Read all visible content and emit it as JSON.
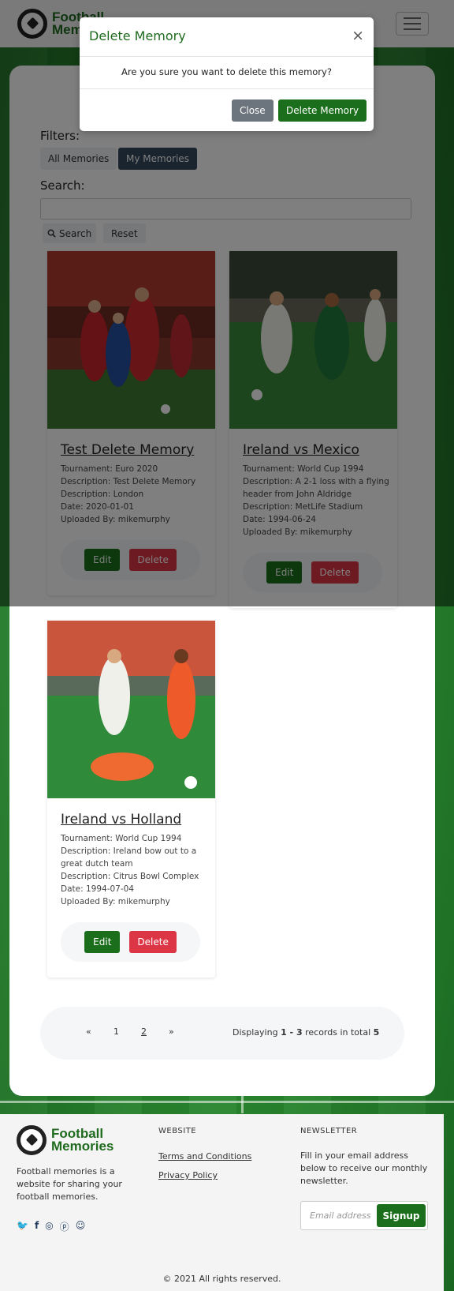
{
  "brand": {
    "name_line1": "Football",
    "name_line2": "Memories"
  },
  "filters": {
    "label": "Filters:",
    "all": "All Memories",
    "mine": "My Memories"
  },
  "search": {
    "label": "Search:",
    "placeholder": "",
    "button": "Search",
    "reset": "Reset"
  },
  "cards": [
    {
      "title": "Test Delete Memory",
      "meta": [
        "Tournament: Euro 2020",
        "Description: Test Delete Memory",
        "Description: London",
        "Date: 2020-01-01",
        "Uploaded By: mikemurphy"
      ],
      "edit": "Edit",
      "delete": "Delete"
    },
    {
      "title": "Ireland vs Mexico",
      "meta": [
        "Tournament: World Cup 1994",
        "Description: A 2-1 loss with a flying header from John Aldridge",
        "Description: MetLife Stadium",
        "Date: 1994-06-24",
        "Uploaded By: mikemurphy"
      ],
      "edit": "Edit",
      "delete": "Delete"
    },
    {
      "title": "Ireland vs Holland",
      "meta": [
        "Tournament: World Cup 1994",
        "Description: Ireland bow out to a great dutch team",
        "Description: Citrus Bowl Complex",
        "Date: 1994-07-04",
        "Uploaded By: mikemurphy"
      ],
      "edit": "Edit",
      "delete": "Delete"
    }
  ],
  "pagination": {
    "prev": "«",
    "page1": "1",
    "page2": "2",
    "next": "»",
    "info_prefix": "Displaying",
    "range": "1 - 3",
    "info_mid": "records in total",
    "total": "5"
  },
  "footer": {
    "description": "Football memories is a website for sharing your football memories.",
    "website_heading": "WEBSITE",
    "links": [
      "Terms and Conditions",
      "Privacy Policy"
    ],
    "newsletter_heading": "NEWSLETTER",
    "newsletter_text": "Fill in your email address below to receive our monthly newsletter.",
    "email_placeholder": "Email address",
    "signup": "Signup",
    "copyright": "© 2021 All rights reserved."
  },
  "modal": {
    "title": "Delete Memory",
    "close_icon": "×",
    "body": "Are you sure you want to delete this memory?",
    "close_button": "Close",
    "confirm_button": "Delete Memory"
  },
  "colors": {
    "brand_green": "#1b6e1b",
    "danger": "#dc3545",
    "secondary": "#6c757d",
    "active_filter": "#34495e"
  }
}
